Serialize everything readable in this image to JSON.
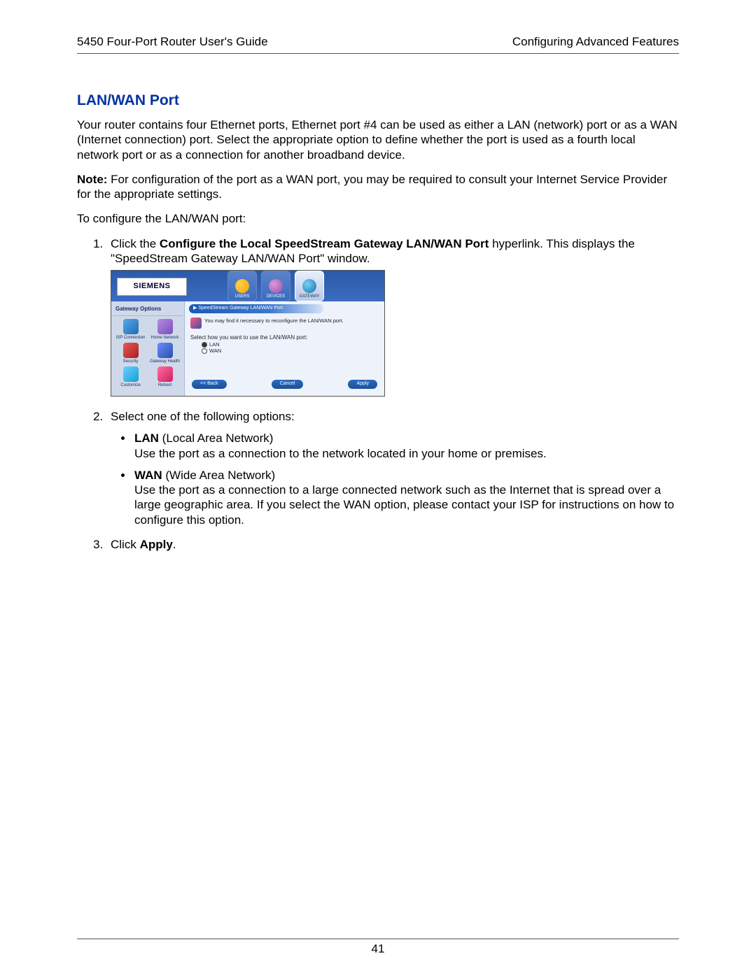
{
  "header": {
    "left": "5450 Four-Port Router User's Guide",
    "right": "Configuring Advanced Features"
  },
  "section_title": "LAN/WAN Port",
  "intro": "Your router contains four Ethernet ports, Ethernet port #4 can be used as either a LAN (network) port or as a WAN (Internet connection) port. Select the appropriate option to define whether the port is used as a fourth local network port or as a connection for another broadband device.",
  "note_label": "Note:",
  "note_text": " For configuration of the port as a WAN port, you may be required to consult your Internet Service Provider for the appropriate settings.",
  "lead": "To configure the LAN/WAN port:",
  "step1_a": "Click the ",
  "step1_b": "Configure the Local SpeedStream Gateway LAN/WAN Port",
  "step1_c": " hyperlink. This displays the \"SpeedStream Gateway LAN/WAN Port\" window.",
  "step2": "Select one of the following options:",
  "opt_lan_b": "LAN",
  "opt_lan_t": " (Local Area Network)",
  "opt_lan_d": "Use the port as a connection  to the network located in your home or premises.",
  "opt_wan_b": "WAN",
  "opt_wan_t": " (Wide Area Network)",
  "opt_wan_d": "Use the port as a connection to a large connected network such as the Internet that is spread over a large geographic area. If you select the WAN option, please contact your ISP for instructions on how to configure this option.",
  "step3_a": "Click ",
  "step3_b": "Apply",
  "step3_c": ".",
  "page_number": "41",
  "ss": {
    "logo": "SIEMENS",
    "tabs": {
      "users": "USERS",
      "devices": "DEVICES",
      "gateway": "GATEWAY"
    },
    "side_h": "Gateway Options",
    "side": {
      "isp": "ISP Connection",
      "home": "Home Network",
      "sec": "Security",
      "gh": "Gateway Health",
      "cus": "Customize",
      "rel": "Reboot"
    },
    "title": "▶  SpeedStream Gateway LAN/WAN Port",
    "msg": "You may find it necessary to reconfigure the LAN/WAN port.",
    "sel": "Select how you want to use the LAN/WAN port:",
    "r_lan": "LAN",
    "r_wan": "WAN",
    "btn_back": "<< Back",
    "btn_cancel": "Cancel",
    "btn_apply": "Apply"
  }
}
